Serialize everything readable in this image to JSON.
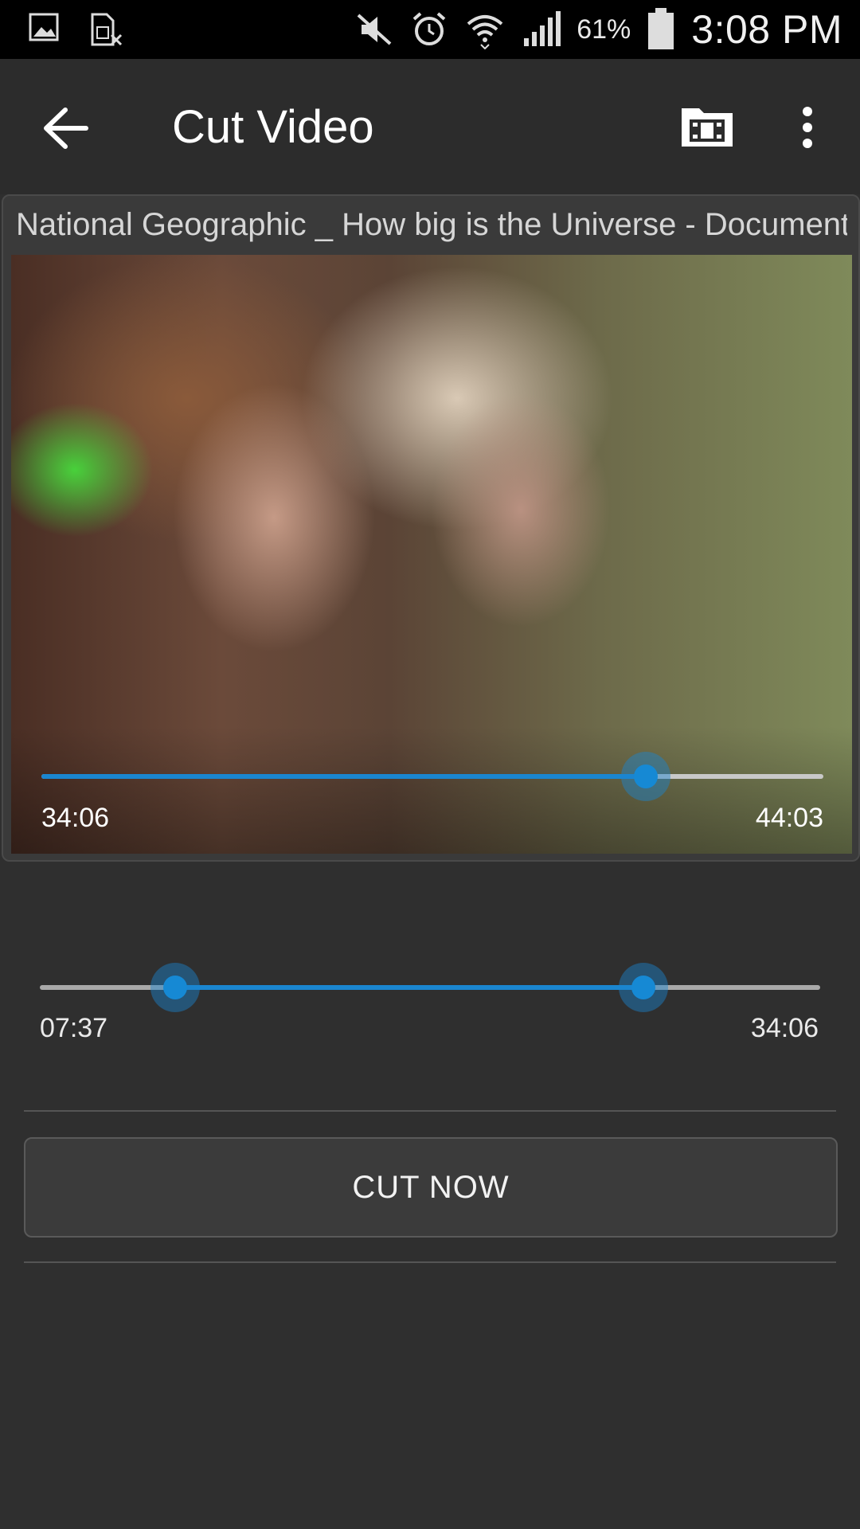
{
  "status_bar": {
    "battery_percent": "61%",
    "time": "3:08 PM",
    "icons": [
      "image-icon",
      "sim-off-icon",
      "mute-icon",
      "alarm-icon",
      "wifi-icon",
      "signal-icon",
      "battery-icon"
    ]
  },
  "app_bar": {
    "title": "Cut Video",
    "icons": [
      "back-arrow-icon",
      "video-folder-icon",
      "more-vert-icon"
    ]
  },
  "video": {
    "title": "National Geographic _ How big is the Universe - Documentary",
    "current_time": "34:06",
    "total_time": "44:03",
    "progress": 0.773
  },
  "range": {
    "start_label": "07:37",
    "end_label": "34:06",
    "start_fraction": 0.173,
    "end_fraction": 0.773
  },
  "actions": {
    "cut_label": "CUT NOW"
  },
  "colors": {
    "accent": "#1a86d0",
    "background": "#2f2f2f",
    "status_bar": "#000000"
  }
}
